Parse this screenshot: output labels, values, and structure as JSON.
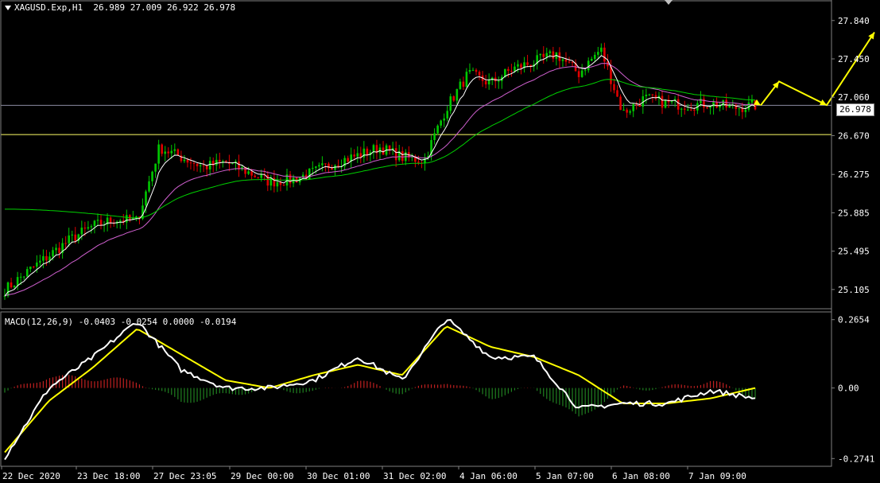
{
  "header": {
    "symbol": "XAGUSD.Exp,H1",
    "ohlc": "26.989 27.009 26.922 26.978"
  },
  "macd_header": "MACD(12,26,9) -0.0403 -0.0254 0.0000 -0.0194",
  "current_price": "26.978",
  "price_axis": [
    "27.840",
    "27.450",
    "27.060",
    "26.670",
    "26.275",
    "25.885",
    "25.495",
    "25.105"
  ],
  "macd_axis": [
    "0.2654",
    "0.00",
    "-0.2741"
  ],
  "time_axis": [
    "22 Dec 2020",
    "23 Dec 18:00",
    "27 Dec 23:05",
    "29 Dec 00:00",
    "30 Dec 01:00",
    "31 Dec 02:00",
    "4 Jan 06:00",
    "5 Jan 07:00",
    "6 Jan 08:00",
    "7 Jan 09:00"
  ],
  "colors": {
    "bull": "#00c800",
    "bear": "#e00000",
    "ma_fast": "#ffffff",
    "ma_mid": "#d060d0",
    "ma_slow": "#00d000",
    "level": "#ffff66",
    "arrow": "#ffff00",
    "macd_line": "#ffffff",
    "signal_line": "#ffff00",
    "grid": "#808080"
  },
  "chart_data": {
    "type": "line",
    "title": "XAGUSD.Exp,H1",
    "ylim": [
      24.95,
      28.0
    ],
    "horizontal_levels": [
      26.978,
      26.68
    ],
    "price_path_x_labels": [
      "22 Dec 2020",
      "23 Dec 18:00",
      "27 Dec 23:05",
      "29 Dec 00:00",
      "30 Dec 01:00",
      "31 Dec 02:00",
      "4 Jan 06:00",
      "5 Jan 07:00",
      "6 Jan 08:00",
      "7 Jan 09:00"
    ],
    "price_path": [
      25.1,
      25.28,
      25.45,
      25.62,
      25.75,
      25.82,
      25.8,
      26.55,
      26.45,
      26.35,
      26.4,
      26.3,
      26.2,
      26.22,
      26.3,
      26.4,
      26.47,
      26.55,
      26.45,
      26.42,
      26.95,
      27.3,
      27.2,
      27.35,
      27.42,
      27.5,
      27.3,
      27.55,
      26.9,
      27.05,
      27.0,
      26.98,
      27.0,
      26.95,
      26.978
    ],
    "forecast_path": [
      26.978,
      27.22,
      26.98,
      27.72
    ],
    "macd_signal": [
      -0.25,
      -0.05,
      0.08,
      0.23,
      0.13,
      0.03,
      0.0,
      0.05,
      0.09,
      0.05,
      0.24,
      0.16,
      0.12,
      0.05,
      -0.06,
      -0.06,
      -0.04,
      0.0
    ],
    "macd_line": [
      -0.27,
      0.0,
      0.12,
      0.26,
      0.07,
      0.0,
      0.0,
      0.03,
      0.12,
      0.03,
      0.27,
      0.12,
      0.12,
      -0.08,
      -0.06,
      -0.06,
      -0.01,
      -0.04
    ]
  }
}
